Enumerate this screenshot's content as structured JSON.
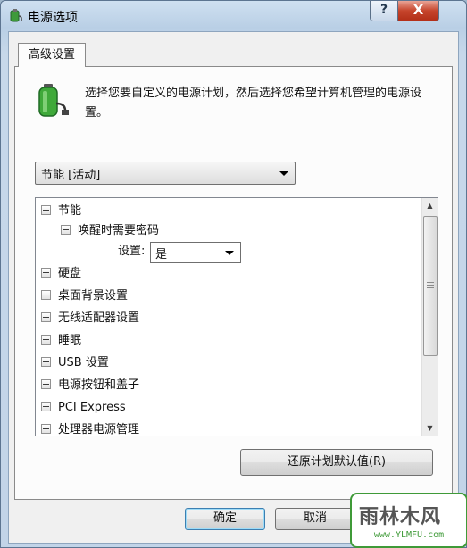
{
  "window": {
    "title": "电源选项",
    "help_label": "?",
    "close_label": "X"
  },
  "tab": {
    "label": "高级设置"
  },
  "description": "选择您要自定义的电源计划，然后选择您希望计算机管理的电源设置。",
  "plan_select": {
    "value": "节能 [活动]"
  },
  "tree": {
    "root": "节能",
    "child": "唤醒时需要密码",
    "setting_label": "设置:",
    "setting_value": "是",
    "items": [
      "硬盘",
      "桌面背景设置",
      "无线适配器设置",
      "睡眠",
      "USB 设置",
      "电源按钮和盖子",
      "PCI Express",
      "处理器电源管理"
    ]
  },
  "buttons": {
    "restore": "还原计划默认值(R)",
    "ok": "确定",
    "cancel": "取消"
  },
  "watermark": {
    "main": "雨林木风",
    "sub": "www.YLMFU.com"
  },
  "icons": {
    "title": "power-options-icon",
    "panel": "battery-plug-icon"
  },
  "colors": {
    "title_gradient_top": "#cfe0f1",
    "close_button": "#c6452c",
    "default_button_border": "#3c7fb1",
    "watermark_green": "#3f9a38"
  }
}
